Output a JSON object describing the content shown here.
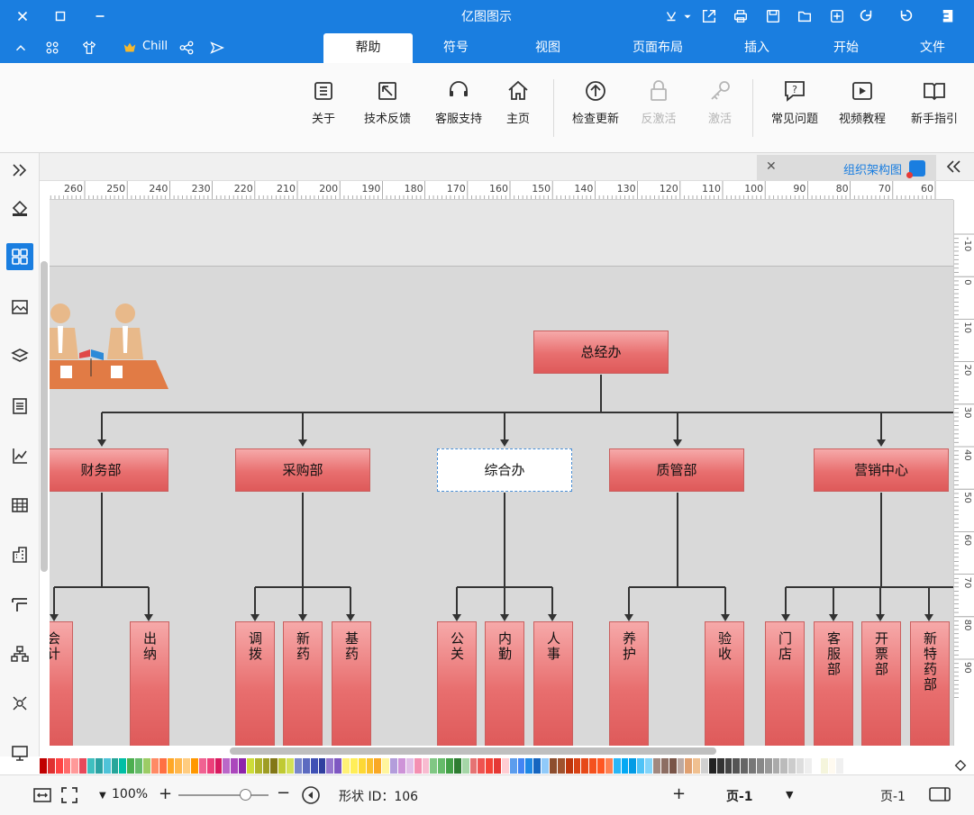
{
  "app": {
    "title": "亿图图示"
  },
  "titlebar": {
    "user": "Chill"
  },
  "ribbon_tabs": [
    "文件",
    "开始",
    "插入",
    "页面布局",
    "视图",
    "符号",
    "帮助"
  ],
  "ribbon_active": "帮助",
  "ribbon": {
    "buttons": [
      "新手指引",
      "视频教程",
      "常见问题",
      "激活",
      "反激活",
      "检查更新",
      "主页",
      "客服支持",
      "技术反馈",
      "关于"
    ]
  },
  "document": {
    "tab_title": "组织架构图"
  },
  "ruler": {
    "h": [
      "60",
      "70",
      "80",
      "90",
      "100",
      "110",
      "120",
      "130",
      "140",
      "150",
      "160",
      "170",
      "180",
      "190",
      "200",
      "210",
      "220",
      "230",
      "240",
      "250",
      "260"
    ],
    "v": [
      "-10",
      "0",
      "10",
      "20",
      "30",
      "40",
      "50",
      "60",
      "70",
      "80",
      "90"
    ]
  },
  "org": {
    "root": "总经办",
    "departments": [
      {
        "name": "营销中心",
        "children": [
          "新特药部",
          "开票部",
          "客服部",
          "门店"
        ]
      },
      {
        "name": "质管部",
        "children": [
          "验收",
          "养护"
        ]
      },
      {
        "name": "综合办",
        "selected": true,
        "children": [
          "人事",
          "内勤",
          "公关"
        ]
      },
      {
        "name": "采购部",
        "children": [
          "基药",
          "新药",
          "调拨"
        ]
      },
      {
        "name": "财务部",
        "children": [
          "出纳",
          "会计"
        ]
      }
    ]
  },
  "palette": [
    "#c00000",
    "#e03030",
    "#ff4444",
    "#ff6b6b",
    "#ff9999",
    "#e8495a",
    "#3fbfbf",
    "#2ba3a3",
    "#4fc3d9",
    "#26a69a",
    "#00bfa5",
    "#4caf50",
    "#66bb6a",
    "#9ccc65",
    "#ff8a65",
    "#ff7043",
    "#ffa726",
    "#ffb74d",
    "#ffcc80",
    "#ff9800",
    "#f06292",
    "#ec407a",
    "#d81b60",
    "#ba68c8",
    "#ab47bc",
    "#8e24aa",
    "#cddc39",
    "#afb42b",
    "#9e9d24",
    "#827717",
    "#c0ca33",
    "#d4e157",
    "#7986cb",
    "#5c6bc0",
    "#3f51b5",
    "#303f9f",
    "#9575cd",
    "#7e57c2",
    "#fff176",
    "#ffee58",
    "#fdd835",
    "#fbc02d",
    "#f9a825",
    "#fff59d",
    "#b39ddb",
    "#ce93d8",
    "#e1bee7",
    "#f48fb1",
    "#f8bbd0",
    "#81c784",
    "#66bb6a",
    "#43a047",
    "#2e7d32",
    "#a5d6a7",
    "#e57373",
    "#ef5350",
    "#f44336",
    "#e53935",
    "#ffcdd2",
    "#5c9ded",
    "#4285f4",
    "#1e88e5",
    "#1565c0",
    "#90caf9",
    "#8d4e2e",
    "#a0522d",
    "#bf360c",
    "#d84315",
    "#e64a19",
    "#f4511e",
    "#ff5722",
    "#ff7f50",
    "#29b6f6",
    "#03a9f4",
    "#039be5",
    "#4fc3f7",
    "#81d4fa",
    "#a1887f",
    "#8d6e63",
    "#795548",
    "#bcaaa4",
    "#e0a070",
    "#f0c090",
    "#d0d0d0",
    "#222222",
    "#333333",
    "#444444",
    "#555555",
    "#666666",
    "#777777",
    "#888888",
    "#999999",
    "#aaaaaa",
    "#bbbbbb",
    "#cccccc",
    "#dddddd",
    "#eeeeee",
    "#ffffff",
    "#f5f5dc",
    "#fffaf0",
    "#f0f0f0"
  ],
  "status": {
    "page_label": "页-1",
    "page_tab": "页-1",
    "shape_id": "形状 ID：106",
    "zoom": "100%"
  }
}
